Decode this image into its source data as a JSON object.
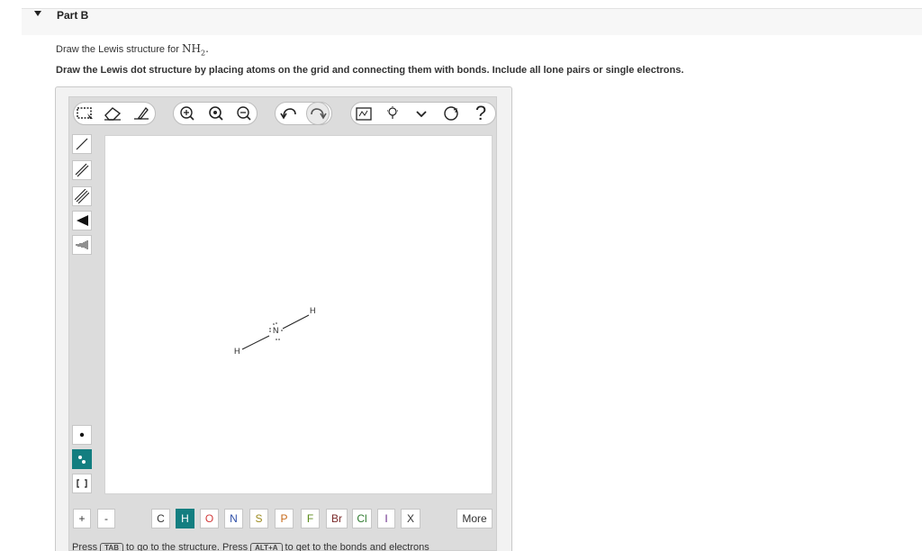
{
  "part": {
    "title": "Part B"
  },
  "question": {
    "prompt_prefix": "Draw the Lewis structure for ",
    "formula_main": "NH",
    "formula_sub": "2",
    "formula_suffix": ".",
    "instruction": "Draw the Lewis dot structure by placing atoms on the grid and connecting them with bonds. Include all lone pairs or single electrons."
  },
  "toolbar": {
    "icons": [
      "selection-icon",
      "eraser-icon",
      "draw-icon",
      "zoom-in-icon",
      "zoom-fit-icon",
      "zoom-out-icon",
      "undo-icon",
      "redo-icon",
      "clean-icon",
      "hint-icon",
      "expand-icon",
      "settings-icon",
      "help-icon"
    ],
    "help_label": "?"
  },
  "left_tools": [
    "single-bond-icon",
    "double-bond-icon",
    "triple-bond-icon",
    "wedge-bond-icon",
    "hash-bond-icon",
    "radical-icon",
    "lone-pair-icon",
    "bracket-icon"
  ],
  "molecule": {
    "atoms": [
      {
        "label": "H"
      },
      {
        "label": "N"
      },
      {
        "label": "H"
      }
    ]
  },
  "elements": {
    "charge_plus": "+",
    "charge_minus": "-",
    "symbols": [
      "C",
      "H",
      "O",
      "N",
      "S",
      "P",
      "F",
      "Br",
      "Cl",
      "I",
      "X"
    ],
    "selected": "H",
    "more_label": "More"
  },
  "footer": {
    "press": "Press",
    "key1": "TAB",
    "mid": "to go to the structure. Press",
    "key2": "ALT+A",
    "end": "to get to the bonds and electrons"
  },
  "colors": {
    "accent": "#137e80",
    "oxygen": "#d23b3b",
    "nitrogen": "#2e4fa8",
    "sulfur": "#9c8a1e",
    "phosphorus": "#c76a1a",
    "fluorine": "#5a8a1a",
    "bromine": "#7a2a2a",
    "chlorine": "#2e7a2e",
    "iodine": "#6a2a8a"
  }
}
